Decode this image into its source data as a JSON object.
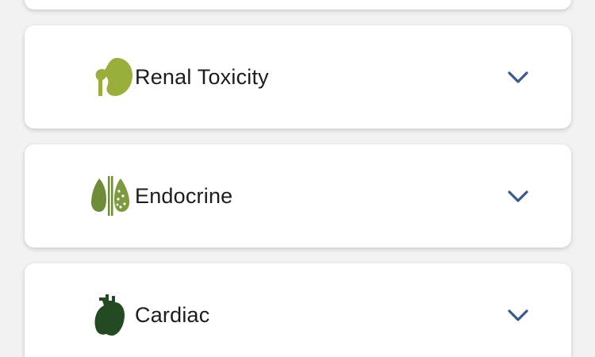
{
  "colors": {
    "background": "#f2f2f2",
    "card": "#ffffff",
    "text": "#1c1c1e",
    "chevron": "#3a5a8c",
    "renal_icon": "#9aae3c",
    "endocrine_icon": "#6e8c3a",
    "cardiac_icon": "#234a23"
  },
  "items": [
    {
      "label": "Renal Toxicity",
      "icon": "kidney-icon",
      "expand_icon": "chevron-down-icon"
    },
    {
      "label": "Endocrine",
      "icon": "thyroid-icon",
      "expand_icon": "chevron-down-icon"
    },
    {
      "label": "Cardiac",
      "icon": "heart-icon",
      "expand_icon": "chevron-down-icon"
    }
  ]
}
